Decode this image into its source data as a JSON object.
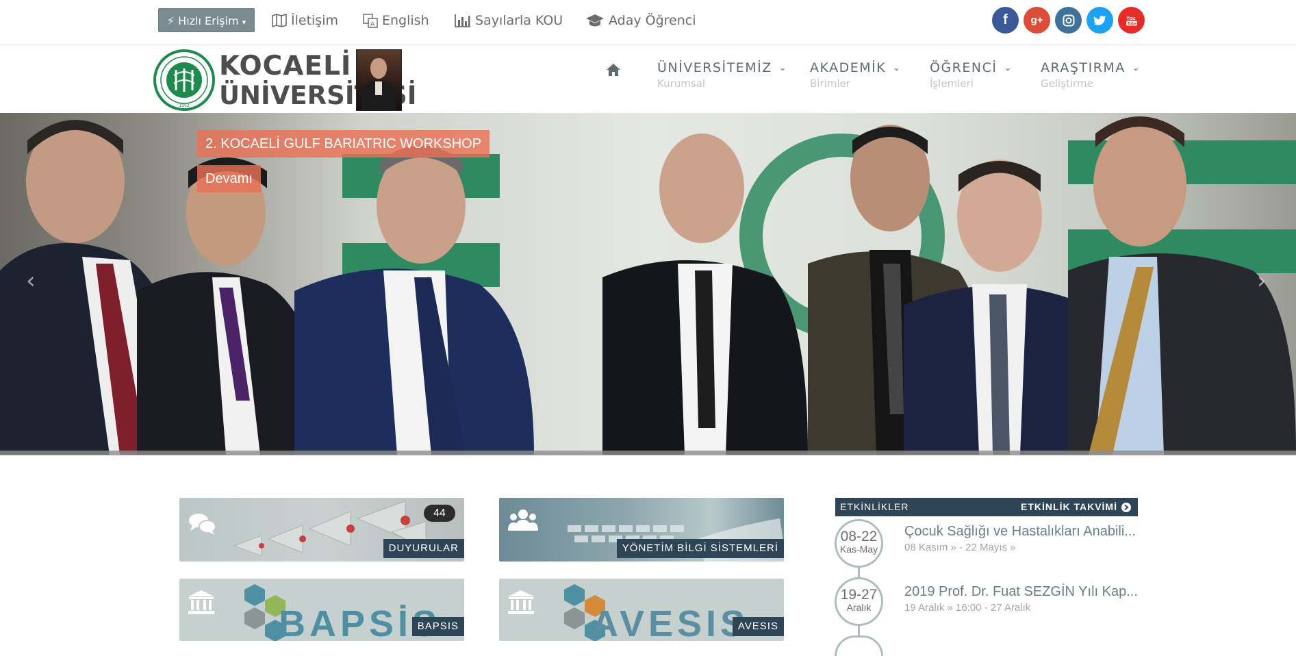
{
  "topbar": {
    "quick_access": "Hızlı Erişim",
    "links": {
      "contact": "İletişim",
      "english": "English",
      "stats": "Sayılarla KOU",
      "candidate": "Aday Öğrenci"
    },
    "social": [
      {
        "icon": "facebook-icon",
        "glyph": "f",
        "color": "#3b5998"
      },
      {
        "icon": "google-plus-icon",
        "glyph": "g+",
        "color": "#dd4b39"
      },
      {
        "icon": "instagram-icon",
        "glyph": "◘",
        "color": "#3f729b"
      },
      {
        "icon": "twitter-icon",
        "glyph": "t",
        "color": "#1da1f2"
      },
      {
        "icon": "youtube-icon",
        "glyph": "▶",
        "color": "#e52d27"
      }
    ]
  },
  "header": {
    "logo_line1": "KOCAELİ",
    "logo_line2": "ÜNİVERSİTESİ",
    "seal_text": "KOCAELİ ÜNİVERSİTESİ",
    "seal_year": "1992",
    "nav": [
      {
        "label": "ÜNİVERSİTEMİZ",
        "sub": "Kurumsal"
      },
      {
        "label": "AKADEMİK",
        "sub": "Birimler"
      },
      {
        "label": "ÖĞRENCİ",
        "sub": "İşlemleri"
      },
      {
        "label": "ARAŞTIRMA",
        "sub": "Geliştirme"
      }
    ]
  },
  "slider": {
    "title": "2. KOCAELİ GULF BARIATRIC WORKSHOP",
    "more": "Devamı"
  },
  "tiles": {
    "duyurular": {
      "label": "DUYURULAR",
      "badge": "44"
    },
    "ybs": {
      "label": "YÖNETİM BİLGİ SİSTEMLERİ"
    },
    "bapsis": {
      "label": "BAPSIS",
      "brand": "BAPSİS"
    },
    "avesis": {
      "label": "AVESIS",
      "brand": "AVESIS"
    }
  },
  "events": {
    "header_left": "ETKİNLİKLER",
    "header_right": "ETKİNLİK TAKVİMİ",
    "items": [
      {
        "range": "08-22",
        "month": "Kas-May",
        "title": "Çocuk Sağlığı ve Hastalıkları Anabili...",
        "date": "08 Kasım » - 22 Mayıs »"
      },
      {
        "range": "19-27",
        "month": "Aralık",
        "title": "2019 Prof. Dr. Fuat SEZGİN Yılı Kap...",
        "date": "19 Aralık » 16:00 - 27 Aralık"
      }
    ]
  }
}
